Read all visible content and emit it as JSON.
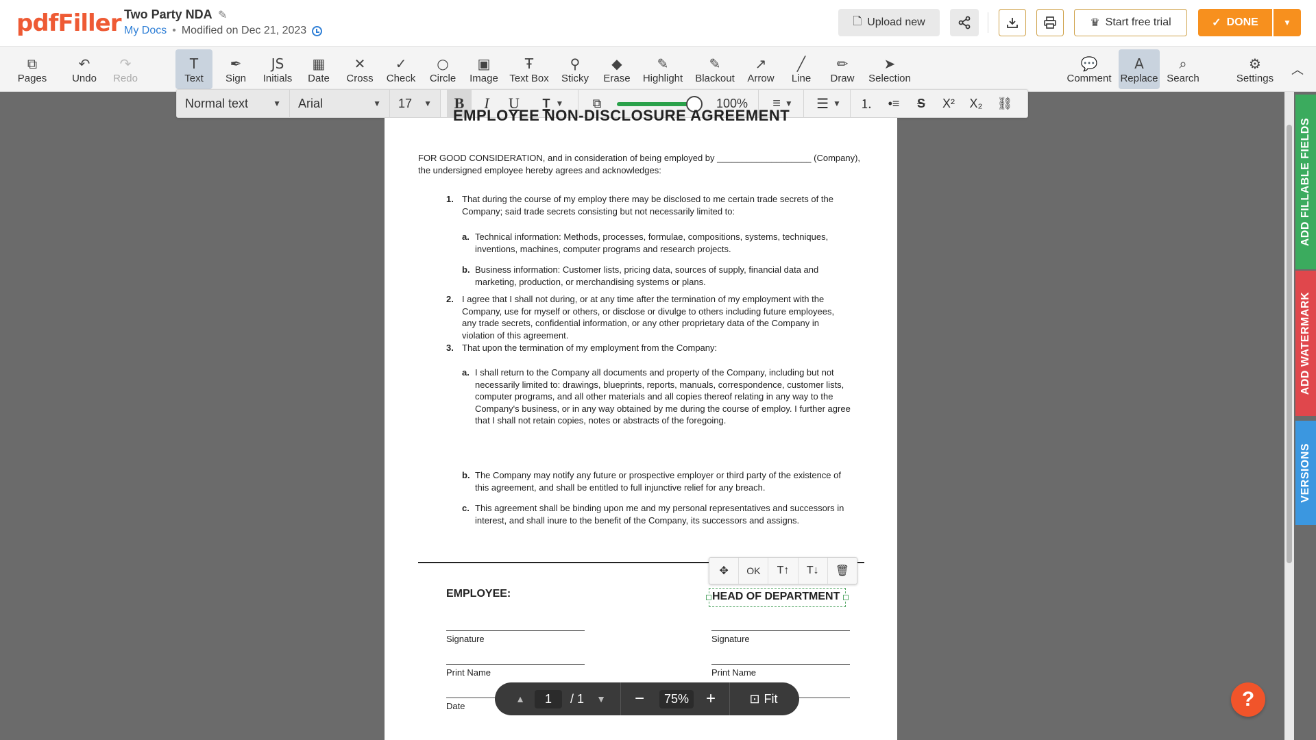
{
  "app": {
    "logo": "pdfFiller"
  },
  "header": {
    "doc_title": "Two Party NDA",
    "edit_icon": "pencil-icon",
    "breadcrumb_link": "My Docs",
    "dot": "•",
    "modified": "Modified on Dec 21, 2023",
    "upload_label": "Upload new",
    "trial_label": "Start free trial",
    "done_label": "DONE",
    "brand_color": "#ee5a34",
    "accent_color": "#f7901e"
  },
  "toolbar": {
    "tools": [
      {
        "label": "Pages",
        "icon": "pages-icon",
        "glyph": "⧉"
      },
      {
        "label": "Undo",
        "icon": "undo-icon",
        "glyph": "↶"
      },
      {
        "label": "Redo",
        "icon": "redo-icon",
        "glyph": "↷"
      },
      {
        "label": "Text",
        "icon": "text-icon",
        "glyph": "T"
      },
      {
        "label": "Sign",
        "icon": "sign-icon",
        "glyph": "✒"
      },
      {
        "label": "Initials",
        "icon": "initials-icon",
        "glyph": "JS"
      },
      {
        "label": "Date",
        "icon": "calendar-icon",
        "glyph": "▦"
      },
      {
        "label": "Cross",
        "icon": "cross-icon",
        "glyph": "✕"
      },
      {
        "label": "Check",
        "icon": "check-icon",
        "glyph": "✓"
      },
      {
        "label": "Circle",
        "icon": "circle-icon",
        "glyph": "○"
      },
      {
        "label": "Image",
        "icon": "image-icon",
        "glyph": "▣"
      },
      {
        "label": "Text Box",
        "icon": "text-box-icon",
        "glyph": "Ŧ"
      },
      {
        "label": "Sticky",
        "icon": "pin-icon",
        "glyph": "⚲"
      },
      {
        "label": "Erase",
        "icon": "eraser-icon",
        "glyph": "◆"
      },
      {
        "label": "Highlight",
        "icon": "highlight-icon",
        "glyph": "✎"
      },
      {
        "label": "Blackout",
        "icon": "blackout-icon",
        "glyph": "✎"
      },
      {
        "label": "Arrow",
        "icon": "arrow-icon",
        "glyph": "↗"
      },
      {
        "label": "Line",
        "icon": "line-icon",
        "glyph": "╱"
      },
      {
        "label": "Draw",
        "icon": "draw-icon",
        "glyph": "✏"
      },
      {
        "label": "Selection",
        "icon": "cursor-icon",
        "glyph": "➤"
      },
      {
        "label": "Comment",
        "icon": "comment-icon",
        "glyph": "💬"
      },
      {
        "label": "Replace",
        "icon": "replace-icon",
        "glyph": "A"
      },
      {
        "label": "Search",
        "icon": "search-icon",
        "glyph": "⌕"
      },
      {
        "label": "Settings",
        "icon": "gear-icon",
        "glyph": "⚙"
      }
    ],
    "active_tools": [
      "Text",
      "Replace"
    ],
    "disabled_tools": [
      "Redo"
    ]
  },
  "format": {
    "style": "Normal text",
    "font": "Arial",
    "size": "17",
    "bold": "B",
    "italic": "I",
    "underline": "U",
    "opacity": "100%"
  },
  "document": {
    "heading": "EMPLOYEE NON-DISCLOSURE AGREEMENT",
    "intro": "FOR GOOD CONSIDERATION, and in consideration of being employed by ___________________  (Company), the undersigned employee hereby agrees and acknowledges:",
    "items": [
      {
        "num": "1.",
        "text": "That during the course of my employ there may be disclosed to me certain trade secrets of the Company; said trade secrets consisting but not necessarily limited to:"
      },
      {
        "num": "a.",
        "text": "Technical information: Methods, processes, formulae, compositions, systems, techniques, inventions, machines, computer programs and research projects."
      },
      {
        "num": "b.",
        "text": "Business information: Customer lists, pricing data, sources of supply, financial data and marketing, production, or merchandising systems or plans."
      },
      {
        "num": "2.",
        "text": "I agree that I shall not during, or at any time after the termination of my employment with the Company, use for myself or others, or disclose or divulge to others including future employees, any trade secrets, confidential information, or any other proprietary data of the Company in violation of this agreement."
      },
      {
        "num": "3.",
        "text": "That upon the termination of my employment from the Company:"
      },
      {
        "num": "a.",
        "text": "I shall return to the Company all documents and property of the Company, including but not necessarily limited to: drawings, blueprints, reports, manuals, correspondence, customer lists, computer programs, and all other materials and all copies thereof relating in any way to the Company's business, or in any way obtained by me during the course of employ. I further agree that I shall not retain copies, notes or abstracts of the foregoing."
      },
      {
        "num": "b.",
        "text": "The Company may notify any future or prospective employer or third party of the existence of this agreement, and shall be entitled to full injunctive relief for any breach."
      },
      {
        "num": "c.",
        "text": "This agreement shall be binding upon me and my personal representatives and successors in interest, and shall inure to the benefit of the Company, its successors and assigns."
      }
    ],
    "employee_label": "EMPLOYEE:",
    "head_label": "HEAD OF DEPARTMENT",
    "signature": "Signature",
    "print_name": "Print Name",
    "date": "Date",
    "field_ok": "OK"
  },
  "side_tabs": {
    "fields": "ADD FILLABLE FIELDS",
    "watermark": "ADD WATERMARK",
    "versions": "VERSIONS"
  },
  "pager": {
    "page": "1",
    "total": "/ 1",
    "zoom": "75%",
    "fit": "Fit"
  },
  "help": "?"
}
